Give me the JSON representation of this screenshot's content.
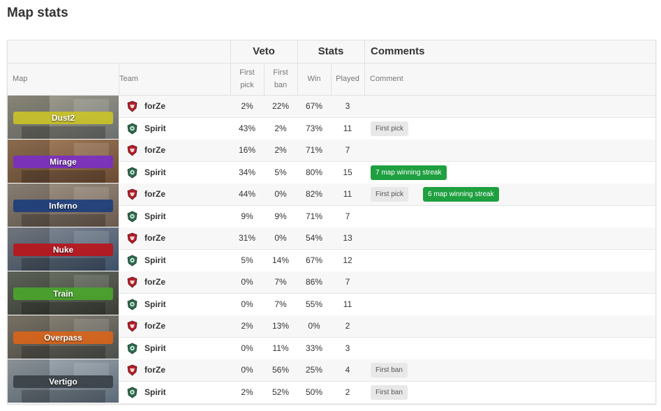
{
  "title": "Map stats",
  "headers": {
    "group_veto": "Veto",
    "group_stats": "Stats",
    "group_comments": "Comments",
    "col_map": "Map",
    "col_team": "Team",
    "col_first_pick_1": "First",
    "col_first_pick_2": "pick",
    "col_first_ban_1": "First",
    "col_first_ban_2": "ban",
    "col_win": "Win",
    "col_played": "Played",
    "col_comment": "Comment"
  },
  "maps": [
    {
      "name": "Dust2",
      "band": "#c9c229",
      "bg": [
        "#6b6f6e",
        "#a7a291"
      ],
      "teams": [
        {
          "team": "forZe",
          "logo": "forze-logo-icon",
          "first_pick": "2%",
          "first_ban": "22%",
          "win": "67%",
          "played": "3",
          "badges": []
        },
        {
          "team": "Spirit",
          "logo": "spirit-logo-icon",
          "first_pick": "43%",
          "first_ban": "2%",
          "win": "73%",
          "played": "11",
          "badges": [
            {
              "text": "First pick",
              "style": "gray"
            }
          ]
        }
      ]
    },
    {
      "name": "Mirage",
      "band": "#7b2fc2",
      "bg": [
        "#6b4a33",
        "#a98461"
      ],
      "teams": [
        {
          "team": "forZe",
          "logo": "forze-logo-icon",
          "first_pick": "16%",
          "first_ban": "2%",
          "win": "71%",
          "played": "7",
          "badges": []
        },
        {
          "team": "Spirit",
          "logo": "spirit-logo-icon",
          "first_pick": "34%",
          "first_ban": "5%",
          "win": "80%",
          "played": "15",
          "badges": [
            {
              "text": "7 map winning streak",
              "style": "green"
            }
          ]
        }
      ]
    },
    {
      "name": "Inferno",
      "band": "#1d3f7c",
      "bg": [
        "#6a5a4d",
        "#a59a8c"
      ],
      "teams": [
        {
          "team": "forZe",
          "logo": "forze-logo-icon",
          "first_pick": "44%",
          "first_ban": "0%",
          "win": "82%",
          "played": "11",
          "badges": [
            {
              "text": "First pick",
              "style": "gray"
            },
            {
              "text": "6 map winning streak",
              "style": "green"
            }
          ]
        },
        {
          "team": "Spirit",
          "logo": "spirit-logo-icon",
          "first_pick": "9%",
          "first_ban": "9%",
          "win": "71%",
          "played": "7",
          "badges": []
        }
      ]
    },
    {
      "name": "Nuke",
      "band": "#b8161c",
      "bg": [
        "#3c5068",
        "#8a8f98"
      ],
      "teams": [
        {
          "team": "forZe",
          "logo": "forze-logo-icon",
          "first_pick": "31%",
          "first_ban": "0%",
          "win": "54%",
          "played": "13",
          "badges": []
        },
        {
          "team": "Spirit",
          "logo": "spirit-logo-icon",
          "first_pick": "5%",
          "first_ban": "14%",
          "win": "67%",
          "played": "12",
          "badges": []
        }
      ]
    },
    {
      "name": "Train",
      "band": "#4aa52c",
      "bg": [
        "#3b3e36",
        "#70786a"
      ],
      "teams": [
        {
          "team": "forZe",
          "logo": "forze-logo-icon",
          "first_pick": "0%",
          "first_ban": "7%",
          "win": "86%",
          "played": "7",
          "badges": []
        },
        {
          "team": "Spirit",
          "logo": "spirit-logo-icon",
          "first_pick": "0%",
          "first_ban": "7%",
          "win": "55%",
          "played": "11",
          "badges": []
        }
      ]
    },
    {
      "name": "Overpass",
      "band": "#d8641a",
      "bg": [
        "#4b4f4c",
        "#93897a"
      ],
      "teams": [
        {
          "team": "forZe",
          "logo": "forze-logo-icon",
          "first_pick": "2%",
          "first_ban": "13%",
          "win": "0%",
          "played": "2",
          "badges": []
        },
        {
          "team": "Spirit",
          "logo": "spirit-logo-icon",
          "first_pick": "0%",
          "first_ban": "11%",
          "win": "33%",
          "played": "3",
          "badges": []
        }
      ]
    },
    {
      "name": "Vertigo",
      "band": "#3a4046",
      "bg": [
        "#5b6a78",
        "#a9b2b8"
      ],
      "teams": [
        {
          "team": "forZe",
          "logo": "forze-logo-icon",
          "first_pick": "0%",
          "first_ban": "56%",
          "win": "25%",
          "played": "4",
          "badges": [
            {
              "text": "First ban",
              "style": "gray"
            }
          ]
        },
        {
          "team": "Spirit",
          "logo": "spirit-logo-icon",
          "first_pick": "2%",
          "first_ban": "52%",
          "win": "50%",
          "played": "2",
          "badges": [
            {
              "text": "First ban",
              "style": "gray"
            }
          ]
        }
      ]
    }
  ]
}
